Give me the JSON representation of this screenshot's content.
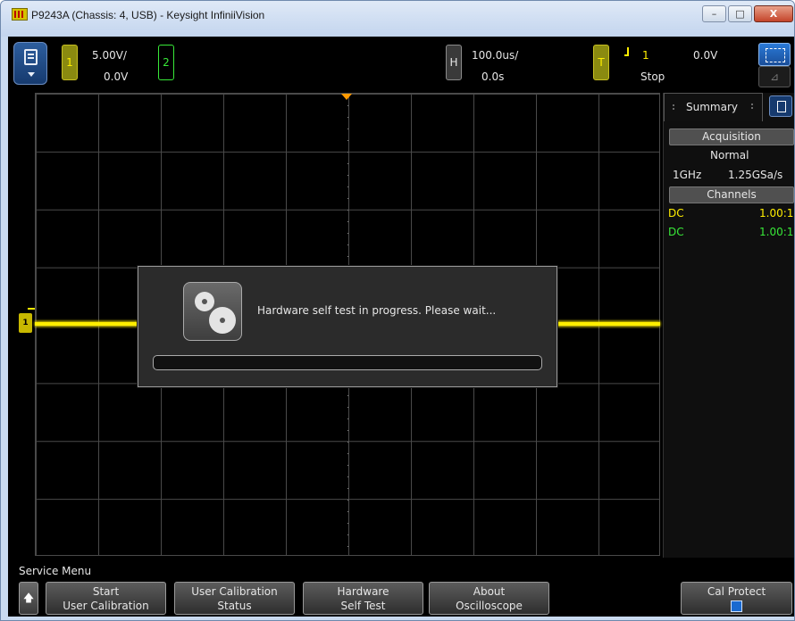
{
  "window": {
    "title": "P9243A (Chassis: 4, USB) - Keysight InfiniiVision",
    "min_label": "–",
    "max_label": "□",
    "close_label": "X"
  },
  "topbar": {
    "ch1": {
      "label": "1",
      "scale": "5.00V/",
      "offset": "0.0V"
    },
    "ch2": {
      "label": "2"
    },
    "horizontal": {
      "label": "H",
      "scale": "100.0us/",
      "delay": "0.0s"
    },
    "trigger": {
      "label": "T",
      "source": "1",
      "level": "0.0V",
      "state": "Stop"
    },
    "measure_icon": "⊿"
  },
  "waveform": {
    "ch1_marker": "1"
  },
  "summary": {
    "tab_label": "Summary",
    "acquisition": {
      "header": "Acquisition",
      "mode": "Normal",
      "bandwidth": "1GHz",
      "sample_rate": "1.25GSa/s"
    },
    "channels": {
      "header": "Channels",
      "rows": [
        {
          "coupling": "DC",
          "probe": "1.00:1"
        },
        {
          "coupling": "DC",
          "probe": "1.00:1"
        }
      ]
    }
  },
  "dialog": {
    "message": "Hardware self test in progress. Please wait...",
    "progress": 0
  },
  "softkeys": {
    "menu_title": "Service Menu",
    "back_icon": "🡅",
    "keys": [
      {
        "line1": "Start",
        "line2": "User Calibration"
      },
      {
        "line1": "User Calibration",
        "line2": "Status"
      },
      {
        "line1": "Hardware",
        "line2": "Self Test"
      },
      {
        "line1": "About",
        "line2": "Oscilloscope"
      }
    ],
    "cal_protect": {
      "label": "Cal Protect",
      "checked": true
    }
  },
  "colors": {
    "ch1": "#ffee00",
    "ch2": "#38e838",
    "trigger_marker": "#ff9a00",
    "accent": "#1a6ad0"
  }
}
